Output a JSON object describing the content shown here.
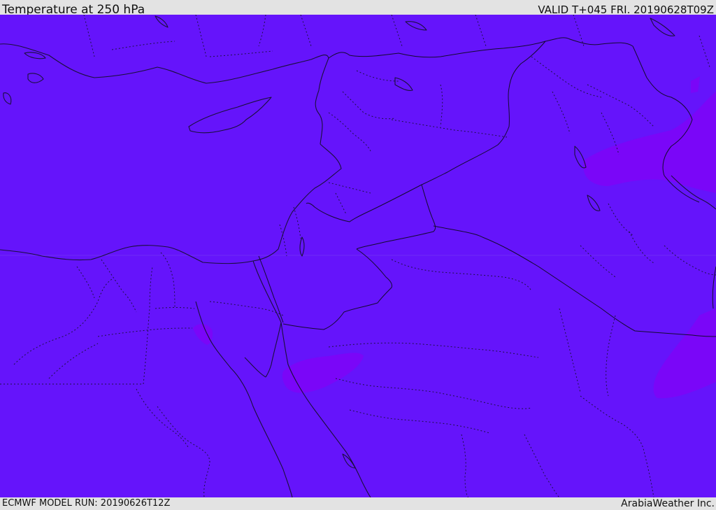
{
  "header": {
    "title": "Temperature at 250 hPa",
    "valid": "VALID T+045 FRI. 20190628T09Z"
  },
  "footer": {
    "model_run": "ECMWF MODEL RUN: 20190626T12Z",
    "credit": "ArabiaWeather Inc."
  },
  "map": {
    "field": "temperature",
    "level": "250 hPa",
    "colors": {
      "background_field": "#6514fb",
      "warm_patch": "#7a06f8",
      "coast_border": "#1a0f3a",
      "internal_border": "#1d1045"
    }
  }
}
